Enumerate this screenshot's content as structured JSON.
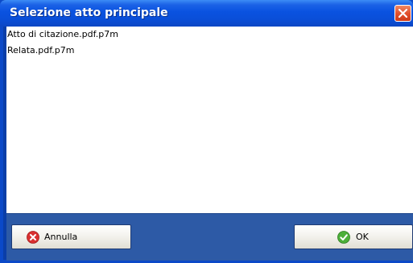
{
  "dialog": {
    "title": "Selezione atto principale",
    "close_icon": "close-icon"
  },
  "files": [
    {
      "name": "Atto di citazione.pdf.p7m"
    },
    {
      "name": "Relata.pdf.p7m"
    }
  ],
  "buttons": {
    "cancel": {
      "label": "Annulla",
      "icon": "cancel-x-icon",
      "icon_color": "#d93030"
    },
    "ok": {
      "label": "OK",
      "icon": "check-icon",
      "icon_color": "#4caf3a"
    }
  },
  "colors": {
    "titlebar": "#0a52e0",
    "close_button": "#e2512e",
    "bottom_bar": "#2d5aa6"
  }
}
